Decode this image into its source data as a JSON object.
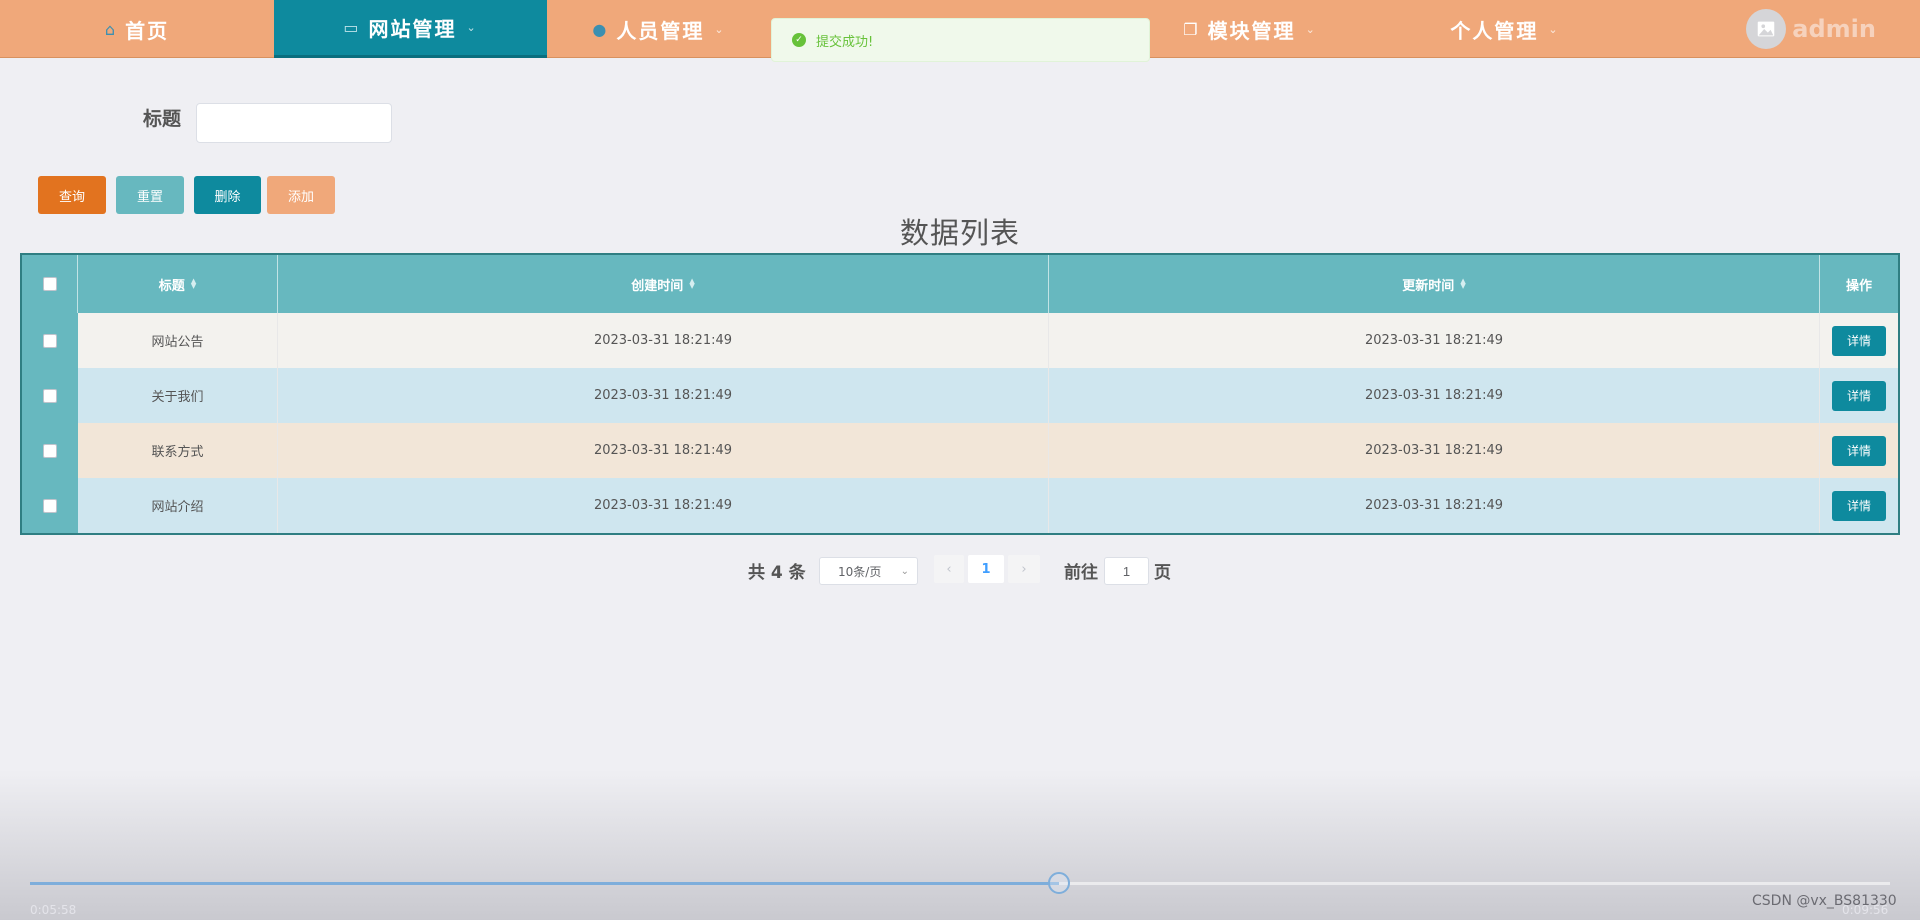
{
  "nav": {
    "items": [
      {
        "label": "首页",
        "icon": "home-icon",
        "active": false,
        "dropdown": false
      },
      {
        "label": "网站管理",
        "icon": "monitor-icon",
        "active": true,
        "dropdown": true
      },
      {
        "label": "人员管理",
        "icon": "user-icon",
        "active": false,
        "dropdown": true
      },
      {
        "label": "模块管理",
        "icon": "copy-icon",
        "active": false,
        "dropdown": true
      },
      {
        "label": "个人管理",
        "icon": "",
        "active": false,
        "dropdown": true
      }
    ],
    "username": "admin",
    "accent": "#0e8a9e",
    "background": "#f0a87a"
  },
  "toast": {
    "message": "提交成功!",
    "color": "#67c23a"
  },
  "search": {
    "label": "标题",
    "value": ""
  },
  "toolbar": {
    "query": "查询",
    "reset": "重置",
    "delete": "删除",
    "add": "添加"
  },
  "list_title": "数据列表",
  "table": {
    "columns": [
      "标题",
      "创建时间",
      "更新时间",
      "操作"
    ],
    "rows": [
      {
        "title": "网站公告",
        "created": "2023-03-31 18:21:49",
        "updated": "2023-03-31 18:21:49",
        "bg": "#f3f2ee"
      },
      {
        "title": "关于我们",
        "created": "2023-03-31 18:21:49",
        "updated": "2023-03-31 18:21:49",
        "bg": "#cfe6ef"
      },
      {
        "title": "联系方式",
        "created": "2023-03-31 18:21:49",
        "updated": "2023-03-31 18:21:49",
        "bg": "#f2e6d8"
      },
      {
        "title": "网站介绍",
        "created": "2023-03-31 18:21:49",
        "updated": "2023-03-31 18:21:49",
        "bg": "#cfe6ef"
      }
    ],
    "action_label": "详情"
  },
  "pagination": {
    "total": "共 4 条",
    "page_size": "10条/页",
    "current_page": "1",
    "goto_prefix": "前往",
    "goto_value": "1",
    "goto_suffix": "页"
  },
  "video": {
    "current_time": "0:05:58",
    "total_time": "0:09:56",
    "progress_fraction": 0.553
  },
  "watermark": "CSDN @vx_BS81330"
}
